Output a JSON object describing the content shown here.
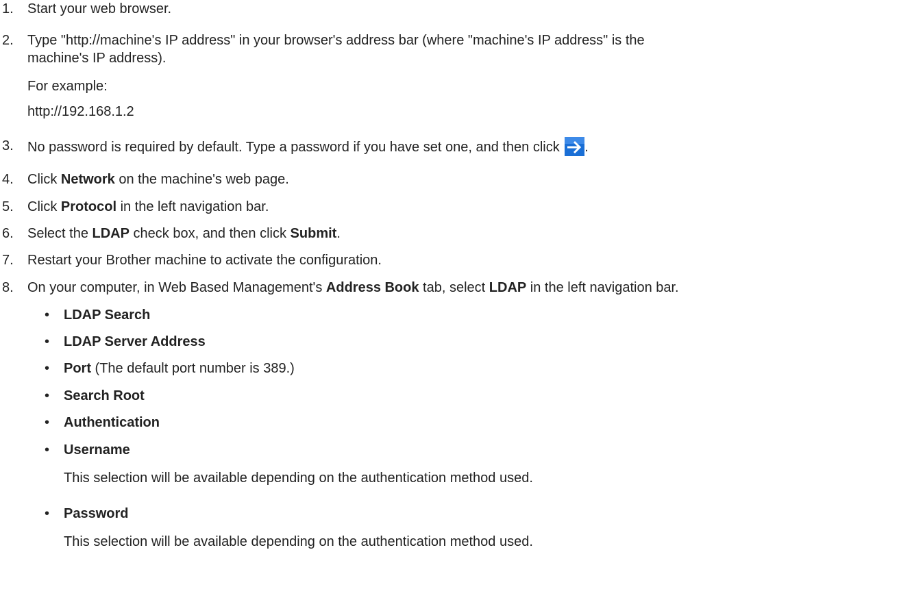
{
  "steps": [
    {
      "num": "1.",
      "text": "Start your web browser."
    },
    {
      "num": "2.",
      "line1": "Type \"http://machine's IP address\" in your browser's address bar (where \"machine's IP address\" is the",
      "line2": "machine's IP address).",
      "example_label": "For example:",
      "example_value": "http://192.168.1.2"
    },
    {
      "num": "3.",
      "before": "No password is required by default. Type a password if you have set one, and then click ",
      "after": ".",
      "icon": "arrow-right-icon"
    },
    {
      "num": "4.",
      "pre": "Click ",
      "bold": "Network",
      "post": " on the machine's web page."
    },
    {
      "num": "5.",
      "pre": "Click ",
      "bold": "Protocol",
      "post": " in the left navigation bar."
    },
    {
      "num": "6.",
      "pre": "Select the ",
      "bold1": "LDAP",
      "mid": " check box, and then click ",
      "bold2": "Submit",
      "post": "."
    },
    {
      "num": "7.",
      "text": "Restart your Brother machine to activate the configuration."
    },
    {
      "num": "8.",
      "pre": "On your computer, in Web Based Management's ",
      "bold1": "Address Book",
      "mid": " tab, select ",
      "bold2": "LDAP",
      "post": " in the left navigation bar."
    }
  ],
  "bullets": {
    "marker": "•",
    "items": [
      {
        "bold": "LDAP Search"
      },
      {
        "bold": "LDAP Server Address"
      },
      {
        "bold": "Port",
        "rest": " (The default port number is 389.)"
      },
      {
        "bold": "Search Root"
      },
      {
        "bold": "Authentication"
      },
      {
        "bold": "Username",
        "note": "This selection will be available depending on the authentication method used."
      },
      {
        "bold": "Password",
        "note": "This selection will be available depending on the authentication method used."
      }
    ]
  },
  "colors": {
    "text": "#222222",
    "icon_bg": "#1a6fd6",
    "icon_fg": "#ffffff"
  }
}
